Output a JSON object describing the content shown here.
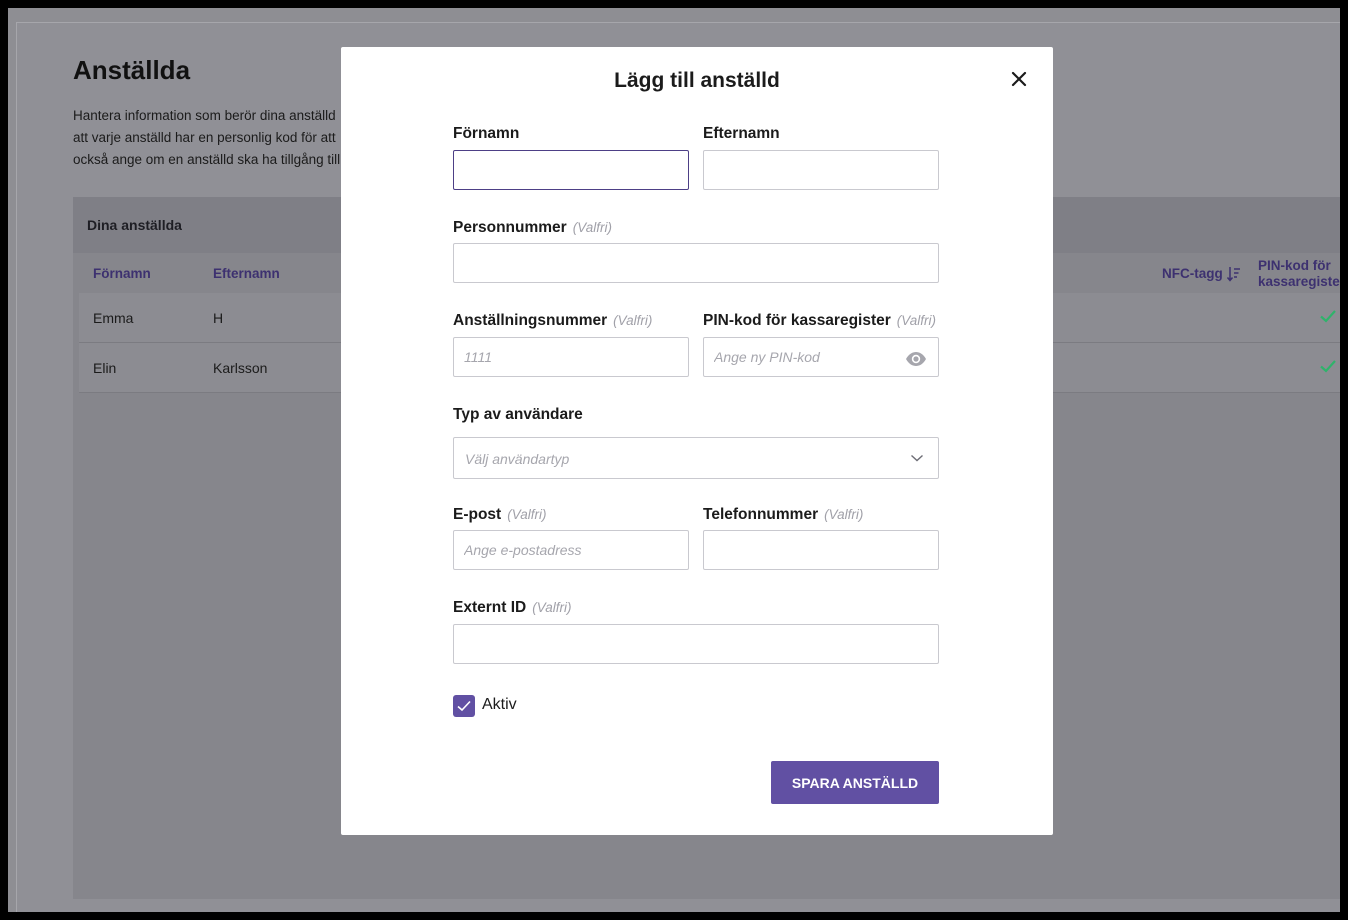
{
  "background": {
    "title": "Anställda",
    "description": "Hantera information som berör dina anställd\natt varje anställd har en personlig kod för att\nockså ange om en anställd ska ha tillgång till",
    "panel_title": "Dina anställda",
    "columns": {
      "first_name": "Förnamn",
      "last_name": "Efternamn",
      "nfc": "NFC-tagg",
      "pin": "PIN-kod för\nkassaregister"
    },
    "rows": [
      {
        "first_name": "Emma",
        "last_name": "H",
        "pin_set": true
      },
      {
        "first_name": "Elin",
        "last_name": "Karlsson",
        "pin_set": true
      }
    ]
  },
  "modal": {
    "title": "Lägg till anställd",
    "optional_tag": "(Valfri)",
    "fields": {
      "first_name": {
        "label": "Förnamn",
        "value": "",
        "placeholder": ""
      },
      "last_name": {
        "label": "Efternamn",
        "value": "",
        "placeholder": ""
      },
      "ssn": {
        "label": "Personnummer",
        "value": "",
        "placeholder": ""
      },
      "employee_number": {
        "label": "Anställningsnummer",
        "value": "",
        "placeholder": "1111"
      },
      "pin": {
        "label": "PIN-kod för kassaregister",
        "value": "",
        "placeholder": "Ange ny PIN-kod"
      },
      "user_type": {
        "label": "Typ av användare",
        "placeholder": "Välj användartyp"
      },
      "email": {
        "label": "E-post",
        "value": "",
        "placeholder": "Ange e-postadress"
      },
      "phone": {
        "label": "Telefonnummer",
        "value": "",
        "placeholder": ""
      },
      "external_id": {
        "label": "Externt ID",
        "value": "",
        "placeholder": ""
      }
    },
    "active": {
      "label": "Aktiv",
      "checked": true
    },
    "save_label": "SPARA ANSTÄLLD"
  },
  "colors": {
    "accent": "#6150a3",
    "check_green": "#2fb36b",
    "overlay": "#8e8e93"
  },
  "icons": {
    "close": "close-icon",
    "eye": "eye-icon",
    "chevron": "chevron-down-icon",
    "sort": "sort-icon",
    "check": "check-icon"
  }
}
